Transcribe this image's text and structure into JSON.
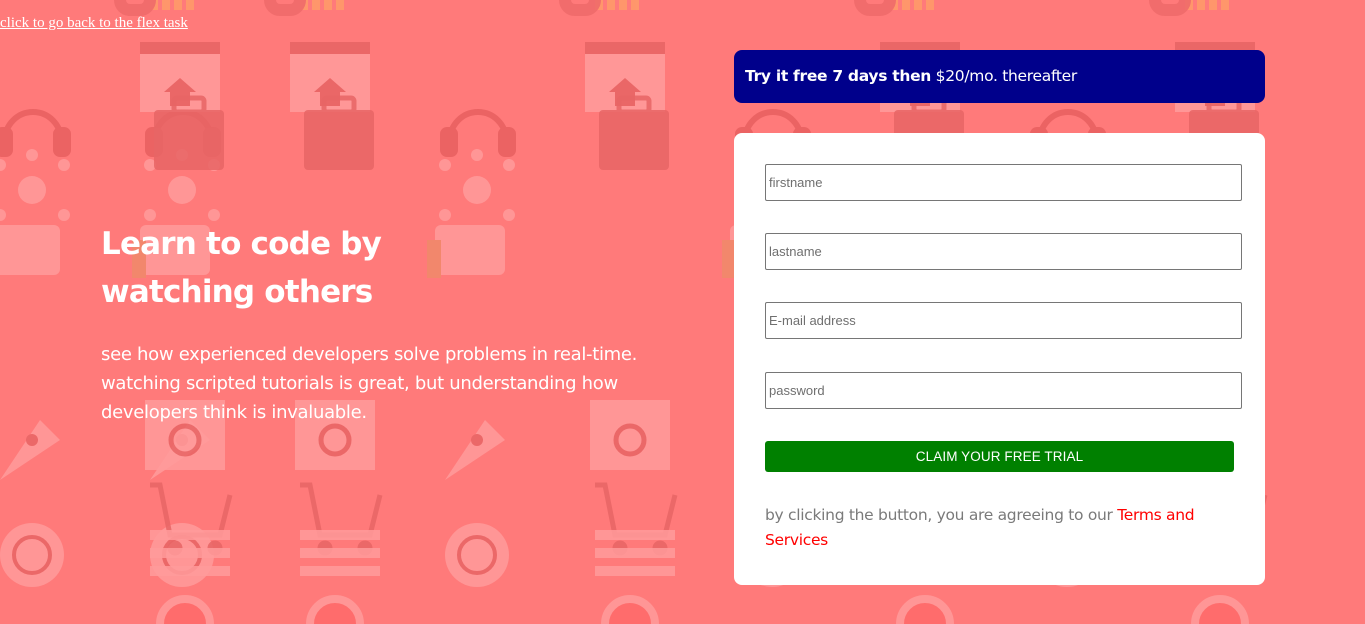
{
  "nav": {
    "back_link": "click to go back to the flex task"
  },
  "hero": {
    "title": "Learn to code by watching others",
    "description": "see how experienced developers solve problems in real-time. watching scripted tutorials is great, but understanding how developers think is invaluable."
  },
  "promo": {
    "bold_text": "Try it free 7 days then",
    "rest_text": "$20/mo. thereafter"
  },
  "form": {
    "firstname_placeholder": "firstname",
    "lastname_placeholder": "lastname",
    "email_placeholder": "E-mail address",
    "password_placeholder": "password",
    "submit_label": "CLAIM YOUR FREE TRIAL",
    "terms_prefix": "by clicking the button, you are agreeing to our",
    "terms_link": "Terms and Services"
  },
  "colors": {
    "background": "#ff7a7a",
    "promo_bg": "#00008b",
    "button_bg": "#008000",
    "link_red": "#ff0000"
  },
  "icons": [
    "bar-chart-icon",
    "browser-window-icon",
    "headset-icon",
    "toolbox-icon",
    "network-icon",
    "thumbs-up-icon",
    "link-icon",
    "rocket-icon",
    "shopping-cart-icon",
    "gear-globe-icon",
    "key-icon",
    "lifebuoy-icon"
  ]
}
